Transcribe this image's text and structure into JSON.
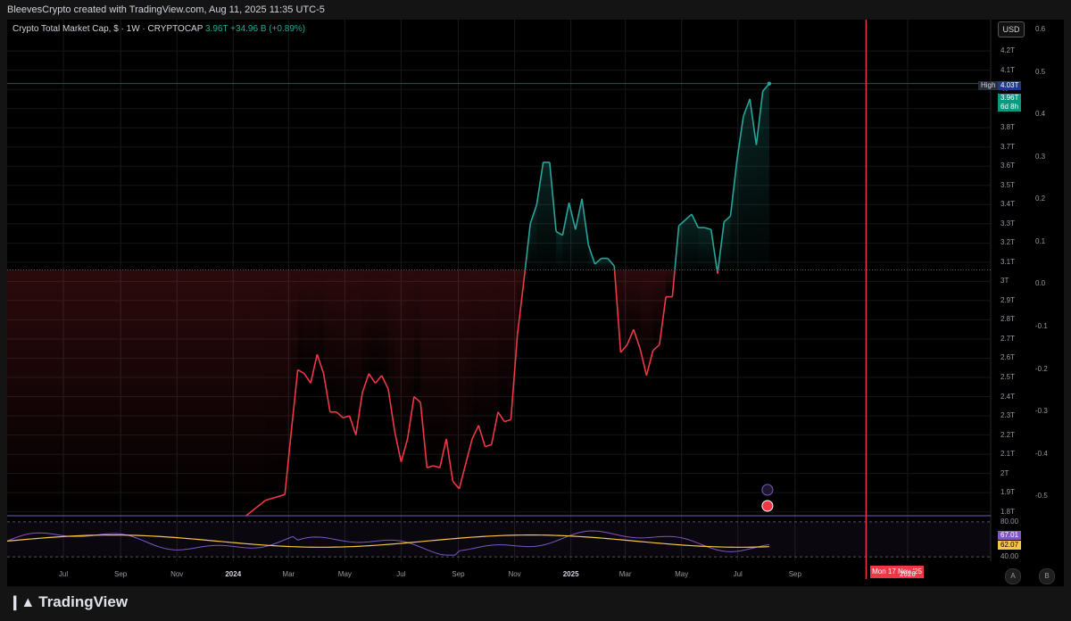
{
  "header": {
    "attribution": "BleevesCrypto created with TradingView.com, Aug 11, 2025 11:35 UTC-5"
  },
  "legend": {
    "symbol": "Crypto Total Market Cap, $ · 1W · CRYPTOCAP",
    "last": "3.96T",
    "change": "+34.96 B (+0.89%)"
  },
  "toolbar": {
    "currency": "USD"
  },
  "tags": {
    "high_label": "High",
    "high_value": "4.03T",
    "last_value": "3.96T",
    "countdown": "6d 8h"
  },
  "cursor_date": "Mon 17 Nov '25",
  "footer": {
    "brand": "TradingView",
    "btn_a": "A",
    "btn_b": "B"
  },
  "chart_data": {
    "type": "line",
    "title": "Crypto Total Market Cap, $ · 1W · CRYPTOCAP",
    "baseline": 3.06,
    "ylim": [
      1.78,
      4.27
    ],
    "y_ticks": [
      "4.2T",
      "4.1T",
      "4T",
      "3.9T",
      "3.8T",
      "3.7T",
      "3.6T",
      "3.5T",
      "3.4T",
      "3.3T",
      "3.2T",
      "3.1T",
      "3T",
      "2.9T",
      "2.8T",
      "2.7T",
      "2.6T",
      "2.5T",
      "2.4T",
      "2.3T",
      "2.2T",
      "2.1T",
      "2T",
      "1.9T",
      "1.8T"
    ],
    "right_ticks": [
      "0.6",
      "0.5",
      "0.4",
      "0.3",
      "0.2",
      "0.1",
      "0.0",
      "-0.1",
      "-0.2",
      "-0.3",
      "-0.4",
      "-0.5"
    ],
    "x_ticks": [
      "Jul",
      "Sep",
      "Nov",
      "2024",
      "Mar",
      "May",
      "Jul",
      "Sep",
      "Nov",
      "2025",
      "Mar",
      "May",
      "Jul",
      "Sep",
      "2026"
    ],
    "x_tick_dates": [
      "2023-07-01",
      "2023-09-01",
      "2023-11-01",
      "2024-01-01",
      "2024-03-01",
      "2024-05-01",
      "2024-07-01",
      "2024-09-01",
      "2024-11-01",
      "2025-01-01",
      "2025-03-01",
      "2025-05-01",
      "2025-07-01",
      "2025-09-01",
      "2026-01-01"
    ],
    "x_range": [
      "2023-05-01",
      "2026-04-01"
    ],
    "cursor": "2025-11-17",
    "colors": {
      "up": "#26a69a",
      "down": "#f23645",
      "rsi": "#7e57c2",
      "rsi_ma": "#f7c548"
    },
    "series": [
      {
        "x": [
          "2024-01-15",
          "2024-02-05",
          "2024-02-26",
          "2024-03-04",
          "2024-03-11",
          "2024-03-18",
          "2024-03-25",
          "2024-04-01",
          "2024-04-08",
          "2024-04-15",
          "2024-04-22",
          "2024-04-29",
          "2024-05-06",
          "2024-05-13",
          "2024-05-20",
          "2024-05-27",
          "2024-06-03",
          "2024-06-10",
          "2024-06-17",
          "2024-06-24",
          "2024-07-01",
          "2024-07-08",
          "2024-07-15",
          "2024-07-22",
          "2024-07-29",
          "2024-08-05",
          "2024-08-12",
          "2024-08-19",
          "2024-08-26",
          "2024-09-02",
          "2024-09-09",
          "2024-09-16",
          "2024-09-23",
          "2024-09-30",
          "2024-10-07",
          "2024-10-14",
          "2024-10-21",
          "2024-10-28",
          "2024-11-04",
          "2024-11-11",
          "2024-11-18",
          "2024-11-25",
          "2024-12-02",
          "2024-12-09",
          "2024-12-16",
          "2024-12-23",
          "2024-12-30",
          "2025-01-06",
          "2025-01-13",
          "2025-01-20",
          "2025-01-27",
          "2025-02-03",
          "2025-02-10",
          "2025-02-17",
          "2025-02-24",
          "2025-03-03",
          "2025-03-10",
          "2025-03-17",
          "2025-03-24",
          "2025-03-31",
          "2025-04-07",
          "2025-04-14",
          "2025-04-21",
          "2025-04-28",
          "2025-05-05",
          "2025-05-12",
          "2025-05-19",
          "2025-05-26",
          "2025-06-02",
          "2025-06-09",
          "2025-06-16",
          "2025-06-23",
          "2025-06-30",
          "2025-07-07",
          "2025-07-14",
          "2025-07-21",
          "2025-07-28",
          "2025-08-04"
        ],
        "values": [
          1.78,
          1.86,
          1.89,
          2.22,
          2.54,
          2.52,
          2.47,
          2.62,
          2.52,
          2.32,
          2.32,
          2.29,
          2.3,
          2.2,
          2.42,
          2.52,
          2.47,
          2.51,
          2.44,
          2.22,
          2.06,
          2.18,
          2.4,
          2.37,
          2.03,
          2.04,
          2.03,
          2.18,
          1.96,
          1.92,
          2.05,
          2.18,
          2.25,
          2.14,
          2.15,
          2.32,
          2.27,
          2.28,
          2.72,
          3.0,
          3.3,
          3.4,
          3.62,
          3.62,
          3.26,
          3.24,
          3.41,
          3.27,
          3.43,
          3.19,
          3.09,
          3.12,
          3.12,
          3.08,
          2.63,
          2.67,
          2.75,
          2.65,
          2.51,
          2.64,
          2.67,
          2.92,
          2.92,
          3.29,
          3.32,
          3.35,
          3.28,
          3.28,
          3.27,
          3.04,
          3.31,
          3.34,
          3.63,
          3.86,
          3.95,
          3.71,
          3.99,
          4.03
        ]
      }
    ],
    "rsi": {
      "ticks": [
        "80.00",
        "40.00"
      ],
      "tick_values": [
        80,
        40
      ],
      "last_rsi": "67.01",
      "last_ma": "62.07",
      "ylim": [
        35,
        85
      ]
    }
  }
}
